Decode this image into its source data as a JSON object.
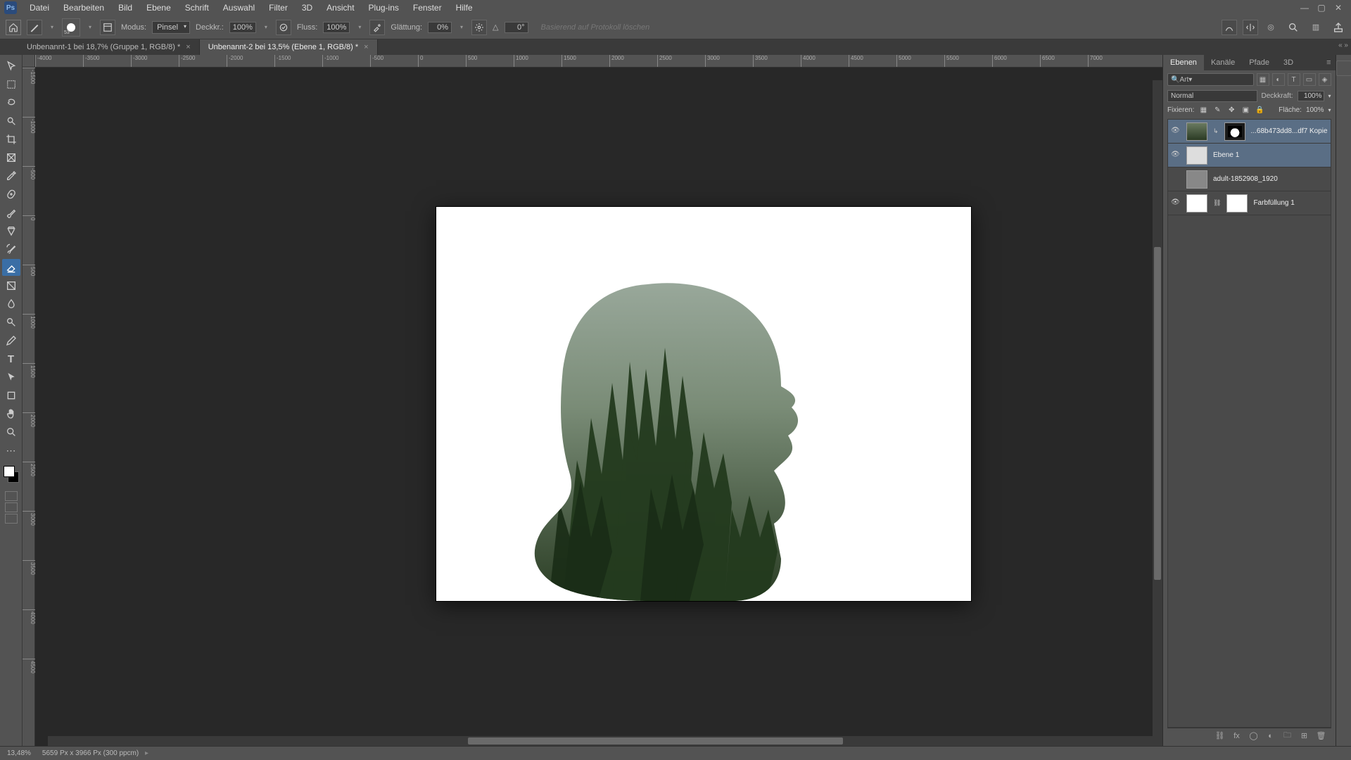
{
  "menu": {
    "items": [
      "Datei",
      "Bearbeiten",
      "Bild",
      "Ebene",
      "Schrift",
      "Auswahl",
      "Filter",
      "3D",
      "Ansicht",
      "Plug-ins",
      "Fenster",
      "Hilfe"
    ]
  },
  "optionsbar": {
    "brush_size": "53",
    "mode_label": "Modus:",
    "mode_value": "Pinsel",
    "opacity_label": "Deckkr.:",
    "opacity_value": "100%",
    "flow_label": "Fluss:",
    "flow_value": "100%",
    "smooth_label": "Glättung:",
    "smooth_value": "0%",
    "angle_label": "△",
    "angle_value": "0°",
    "hint_text": "Basierend auf Protokoll löschen"
  },
  "tabs": {
    "tab1": "Unbenannt-1 bei 18,7% (Gruppe 1, RGB/8) *",
    "tab2": "Unbenannt-2 bei 13,5% (Ebene 1, RGB/8) *"
  },
  "ruler_h": [
    "-4000",
    "-3500",
    "-3000",
    "-2500",
    "-2000",
    "-1500",
    "-1000",
    "-500",
    "0",
    "500",
    "1000",
    "1500",
    "2000",
    "2500",
    "3000",
    "3500",
    "4000",
    "4500",
    "5000",
    "5500",
    "6000",
    "6500",
    "7000"
  ],
  "ruler_v": [
    "-1500",
    "-1000",
    "-500",
    "0",
    "500",
    "1000",
    "1500",
    "2000",
    "2500",
    "3000",
    "3500",
    "4000",
    "4500"
  ],
  "panels": {
    "tabs": [
      "Ebenen",
      "Kanäle",
      "Pfade",
      "3D"
    ],
    "filter_label": "Art",
    "blend_mode": "Normal",
    "opacity_label": "Deckkraft:",
    "opacity_value": "100%",
    "lock_label": "Fixieren:",
    "fill_label": "Fläche:",
    "fill_value": "100%",
    "layers": [
      {
        "visible": true,
        "has_mask": true,
        "name": "...68b473dd8...df7 Kopie",
        "clipped": true
      },
      {
        "visible": true,
        "has_mask": false,
        "name": "Ebene 1"
      },
      {
        "visible": false,
        "has_mask": false,
        "name": "adult-1852908_1920"
      },
      {
        "visible": true,
        "has_mask": true,
        "name": "Farbfüllung 1",
        "fill_white": true
      }
    ]
  },
  "statusbar": {
    "zoom": "13,48%",
    "info": "5659 Px x 3966 Px (300 ppcm)"
  }
}
